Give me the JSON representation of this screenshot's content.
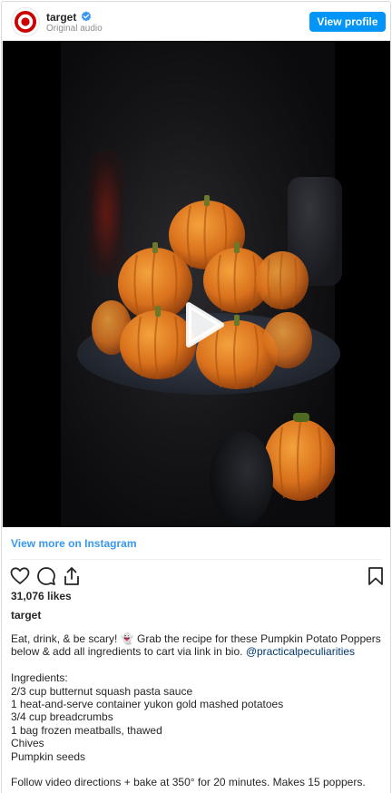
{
  "header": {
    "username": "target",
    "subtitle": "Original audio",
    "view_profile_label": "View profile",
    "verified_icon": "verified-badge-icon",
    "avatar_icon": "target-logo-icon"
  },
  "media": {
    "type": "video",
    "play_icon": "play-icon"
  },
  "footer": {
    "view_more_label": "View more on Instagram",
    "actions": [
      "heart-icon",
      "comment-icon",
      "share-icon",
      "bookmark-icon"
    ],
    "likes": "31,076 likes",
    "owner": "target",
    "caption": {
      "line1": "Eat, drink, & be scary! 👻 Grab the recipe for these Pumpkin Potato Poppers",
      "line2_prefix": "below & add all ingredients to cart via link in bio. ",
      "mention": "@practicalpeculiarities",
      "ingredients_heading": "Ingredients:",
      "ingredients": [
        "2/3 cup butternut squash pasta sauce",
        "1 heat-and-serve container yukon gold mashed potatoes",
        "3/4 cup breadcrumbs",
        "1 bag frozen meatballs, thawed",
        "Chives",
        "Pumpkin seeds"
      ],
      "directions": "Follow video directions + bake at 350° for 20 minutes. Makes 15 poppers."
    }
  },
  "colors": {
    "accent": "#0095f6",
    "link": "#3897f0",
    "mention": "#00376b",
    "brand_red": "#cc0000",
    "text": "#262626",
    "muted": "#8e8e8e"
  }
}
